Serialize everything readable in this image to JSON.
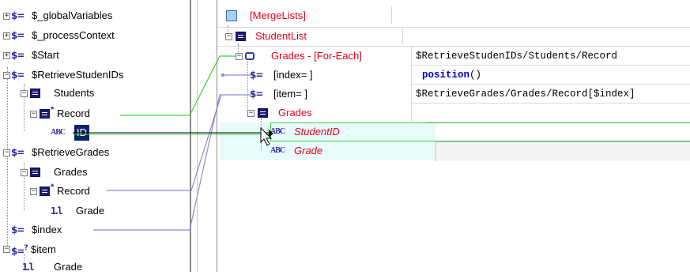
{
  "left_tree": {
    "items": [
      {
        "label": "$_globalVariables"
      },
      {
        "label": "$_processContext"
      },
      {
        "label": "$Start"
      },
      {
        "label": "$RetrieveStudenIDs"
      },
      {
        "label": "Students"
      },
      {
        "label": "Record"
      },
      {
        "label": "ID"
      },
      {
        "label": "$RetrieveGrades"
      },
      {
        "label": "Grades"
      },
      {
        "label": "Record"
      },
      {
        "label": "Grade"
      },
      {
        "label": "$index"
      },
      {
        "label": "$item"
      },
      {
        "label": "Grade"
      }
    ]
  },
  "right_tree": {
    "items": [
      {
        "label": "[MergeLists]"
      },
      {
        "label": "StudentList"
      },
      {
        "label": "Grades - [For-Each]",
        "value": "$RetrieveStudenIDs/Students/Record"
      },
      {
        "label": "[index= ]",
        "value_fn": "position",
        "value_paren": "()"
      },
      {
        "label": "[item= ]",
        "value": "$RetrieveGrades/Grades/Record[$index]"
      },
      {
        "label": "Grades"
      },
      {
        "label": "StudentID"
      },
      {
        "label": "Grade"
      }
    ]
  },
  "colors": {
    "required_label": "#e0001b",
    "link_blue": "#8b8bd6",
    "link_green": "#3cd23c",
    "selection": "#0a246a"
  }
}
